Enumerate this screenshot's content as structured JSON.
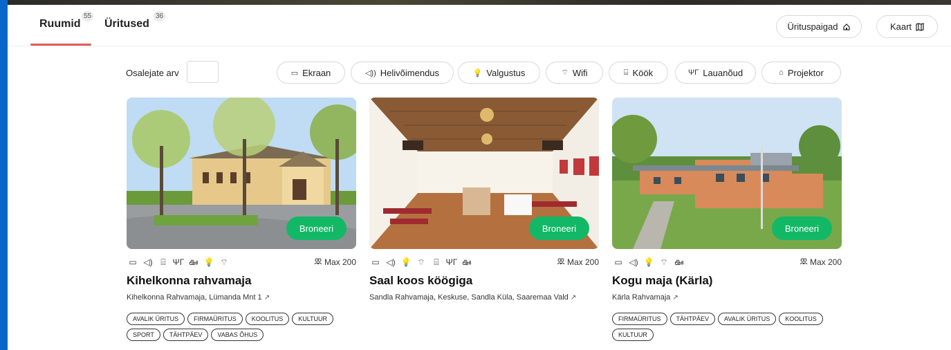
{
  "colors": {
    "accent": "#e25b5b",
    "book": "#12b866",
    "sidebar": "#0a67c9"
  },
  "tabs": [
    {
      "label": "Ruumid",
      "count": "55",
      "active": true
    },
    {
      "label": "Üritused",
      "count": "36",
      "active": false
    }
  ],
  "header_buttons": {
    "venues": "Ürituspaigad",
    "venues_icon": "home-icon",
    "map": "Kaart",
    "map_icon": "map-icon"
  },
  "filters": {
    "participants_label": "Osalejate arv",
    "participants_value": "",
    "chips": [
      {
        "label": "Ekraan",
        "icon": "▭"
      },
      {
        "label": "Helivõimendus",
        "icon": "◁))"
      },
      {
        "label": "Valgustus",
        "icon": "💡"
      },
      {
        "label": "Wifi",
        "icon": "⌔"
      },
      {
        "label": "Köök",
        "icon": "⌸"
      },
      {
        "label": "Lauanõud",
        "icon": "ΨΓ"
      },
      {
        "label": "Projektor",
        "icon": "⌂"
      }
    ]
  },
  "book_label": "Broneeri",
  "cards": [
    {
      "title": "Kihelkonna rahvamaja",
      "address": "Kihelkonna Rahvamaja, Lümanda Mnt 1",
      "capacity": "Max 200",
      "amenities": [
        "▭",
        "◁)",
        "⌸",
        "ΨΓ",
        "ఊ",
        "💡",
        "⌔"
      ],
      "tags": [
        "AVALIK ÜRITUS",
        "FIRMAÜRITUS",
        "KOOLITUS",
        "KULTUUR",
        "SPORT",
        "TÄHTPÄEV",
        "VABAS ÕHUS"
      ]
    },
    {
      "title": "Saal koos köögiga",
      "address": "Sandla Rahvamaja, Keskuse, Sandla Küla, Saaremaa Vald",
      "capacity": "Max 200",
      "amenities": [
        "▭",
        "◁)",
        "💡",
        "⌔",
        "⌸",
        "ΨΓ",
        "ఊ"
      ],
      "tags": []
    },
    {
      "title": "Kogu maja (Kärla)",
      "address": "Kärla Rahvamaja",
      "capacity": "Max 200",
      "amenities": [
        "▭",
        "◁)",
        "💡",
        "⌔",
        "ఊ"
      ],
      "tags": [
        "FIRMAÜRITUS",
        "TÄHTPÄEV",
        "AVALIK ÜRITUS",
        "KOOLITUS",
        "KULTUUR"
      ]
    }
  ]
}
